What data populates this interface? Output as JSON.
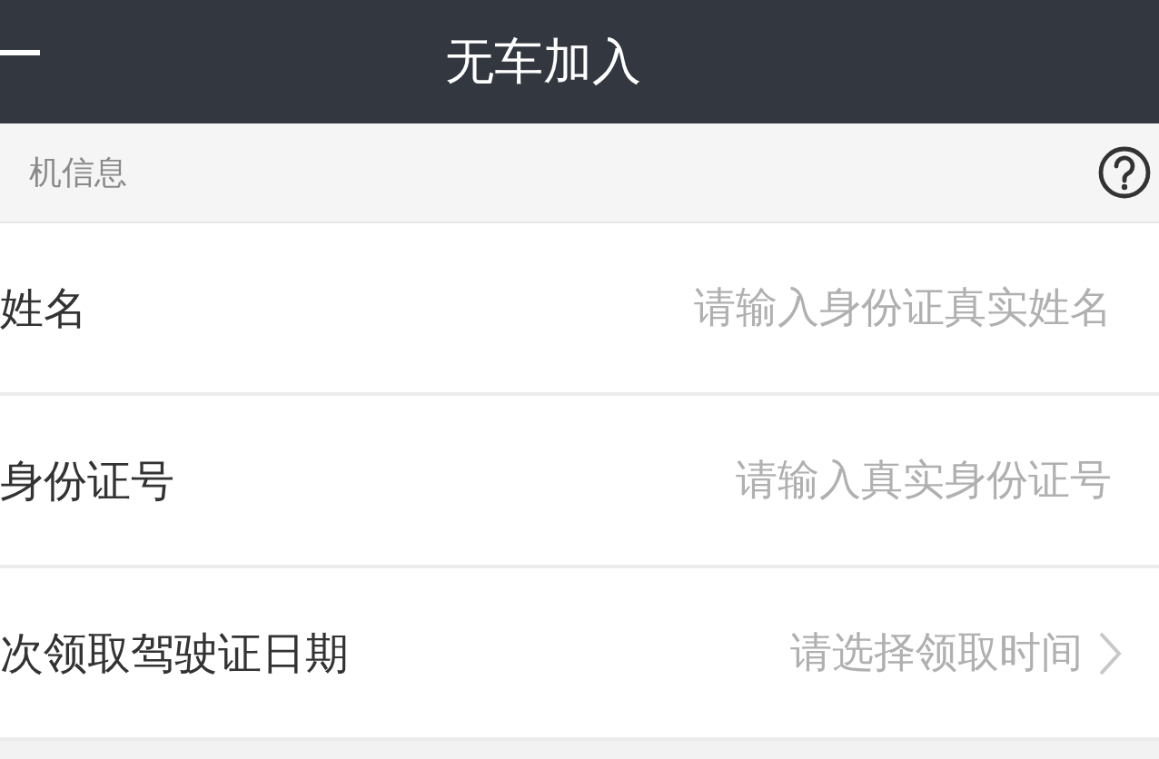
{
  "nav_bar": {
    "title": "无车加入"
  },
  "section": {
    "title": "机信息"
  },
  "rows": [
    {
      "kind": "input",
      "label": "姓名",
      "placeholder": "请输入身份证真实姓名"
    },
    {
      "kind": "input",
      "label": "身份证号",
      "placeholder": "请输入真实身份证号"
    },
    {
      "kind": "picker",
      "label": "次领取驾驶证日期",
      "value": "请选择领取时间"
    }
  ]
}
